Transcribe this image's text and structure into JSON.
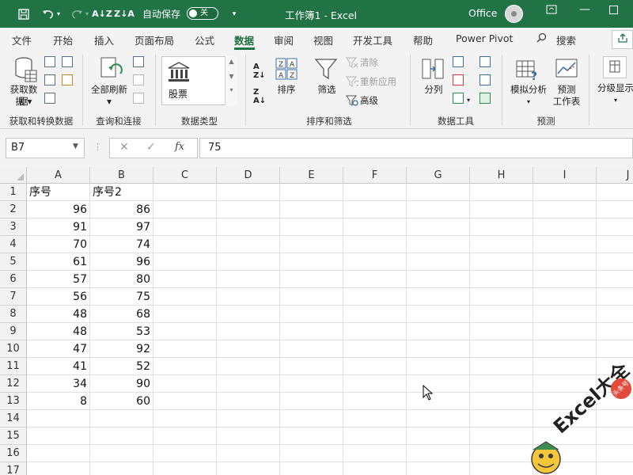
{
  "titlebar": {
    "autosave_label": "自动保存",
    "autosave_state": "关",
    "doc_title": "工作簿1  -  Excel",
    "office_label": "Office",
    "accent": "#217346"
  },
  "menu": {
    "tabs": [
      "文件",
      "开始",
      "插入",
      "页面布局",
      "公式",
      "数据",
      "审阅",
      "视图",
      "开发工具",
      "帮助",
      "Power Pivot"
    ],
    "active_tab": "数据",
    "search_label": "搜索"
  },
  "ribbon": {
    "get_data": "获取数据",
    "get_data_2": "据",
    "group_get_transform": "获取和转换数据",
    "refresh_all": "全部刷新",
    "group_queries": "查询和连接",
    "stock": "股票",
    "group_datatypes": "数据类型",
    "sort": "排序",
    "filter": "筛选",
    "clear": "清除",
    "reapply": "重新应用",
    "advanced": "高级",
    "group_sort_filter": "排序和筛选",
    "text_to_columns": "分列",
    "group_data_tools": "数据工具",
    "what_if": "模拟分析",
    "forecast_sheet_1": "预测",
    "forecast_sheet_2": "工作表",
    "group_forecast": "预测",
    "outline": "分级显示"
  },
  "formula_bar": {
    "name_box": "B7",
    "formula": "75",
    "fx": "fx"
  },
  "grid": {
    "columns": [
      "A",
      "B",
      "C",
      "D",
      "E",
      "F",
      "G",
      "H",
      "I",
      "J"
    ],
    "rows": [
      "1",
      "2",
      "3",
      "4",
      "5",
      "6",
      "7",
      "8",
      "9",
      "10",
      "11",
      "12",
      "13",
      "14",
      "15",
      "16",
      "17"
    ],
    "header_row": [
      "序号",
      "序号2"
    ],
    "data": [
      [
        "96",
        "86"
      ],
      [
        "91",
        "97"
      ],
      [
        "70",
        "74"
      ],
      [
        "61",
        "96"
      ],
      [
        "57",
        "80"
      ],
      [
        "56",
        "75"
      ],
      [
        "48",
        "68"
      ],
      [
        "48",
        "53"
      ],
      [
        "47",
        "92"
      ],
      [
        "41",
        "52"
      ],
      [
        "34",
        "90"
      ],
      [
        "8",
        "60"
      ]
    ],
    "selected_cell": "B7"
  },
  "watermark": {
    "text": "Excel大全",
    "badge": "头条号"
  }
}
